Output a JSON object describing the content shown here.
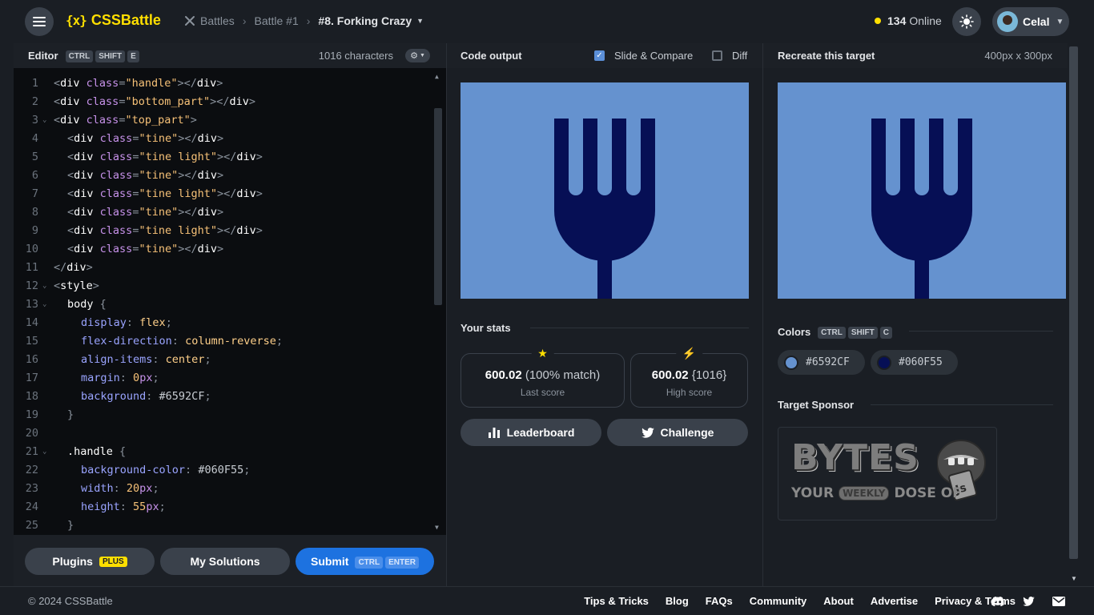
{
  "header": {
    "logo_mark": "{x}",
    "logo_text": "CSSBattle",
    "crumb_battles": "Battles",
    "crumb_battle": "Battle #1",
    "crumb_current": "#8. Forking Crazy",
    "online_count": "134",
    "online_label": "Online",
    "user_name": "Celal",
    "accent_color": "#ffdf00"
  },
  "editor": {
    "title": "Editor",
    "shortcut_keys": [
      "CTRL",
      "SHIFT",
      "E"
    ],
    "char_count": "1016 characters",
    "line_numbers": [
      "1",
      "2",
      "3",
      "4",
      "5",
      "6",
      "7",
      "8",
      "9",
      "10",
      "11",
      "12",
      "13",
      "14",
      "15",
      "16",
      "17",
      "18",
      "19",
      "20",
      "21",
      "22",
      "23",
      "24",
      "25"
    ],
    "lines": {
      "l1": [
        "<",
        "div",
        " class",
        "=",
        "\"handle\"",
        "></",
        "div",
        ">"
      ],
      "l2": [
        "<",
        "div",
        " class",
        "=",
        "\"bottom_part\"",
        "></",
        "div",
        ">"
      ],
      "l3": [
        "<",
        "div",
        " class",
        "=",
        "\"top_part\"",
        ">"
      ],
      "l4": [
        "<",
        "div",
        " class",
        "=",
        "\"tine\"",
        "></",
        "div",
        ">"
      ],
      "l5": [
        "<",
        "div",
        " class",
        "=",
        "\"tine light\"",
        "></",
        "div",
        ">"
      ],
      "l6": [
        "<",
        "div",
        " class",
        "=",
        "\"tine\"",
        "></",
        "div",
        ">"
      ],
      "l7": [
        "<",
        "div",
        " class",
        "=",
        "\"tine light\"",
        "></",
        "div",
        ">"
      ],
      "l8": [
        "<",
        "div",
        " class",
        "=",
        "\"tine\"",
        "></",
        "div",
        ">"
      ],
      "l9": [
        "<",
        "div",
        " class",
        "=",
        "\"tine light\"",
        "></",
        "div",
        ">"
      ],
      "l10": [
        "<",
        "div",
        " class",
        "=",
        "\"tine\"",
        "></",
        "div",
        ">"
      ],
      "l11": [
        "</",
        "div",
        ">"
      ],
      "l12": [
        "<",
        "style",
        ">"
      ],
      "l13": [
        "body",
        " {"
      ],
      "l14": [
        "display",
        ": ",
        "flex",
        ";"
      ],
      "l15": [
        "flex-direction",
        ": ",
        "column-reverse",
        ";"
      ],
      "l16": [
        "align-items",
        ": ",
        "center",
        ";"
      ],
      "l17": [
        "margin",
        ": ",
        "0",
        "px",
        ";"
      ],
      "l18": [
        "background",
        ": ",
        "#6592CF",
        ";"
      ],
      "l19": [
        "}"
      ],
      "l21": [
        ".handle",
        " {"
      ],
      "l22": [
        "background-color",
        ": ",
        "#060F55",
        ";"
      ],
      "l23": [
        "width",
        ": ",
        "20",
        "px",
        ";"
      ],
      "l24": [
        "height",
        ": ",
        "55",
        "px",
        ";"
      ],
      "l25": [
        "}"
      ]
    },
    "plugins_label": "Plugins",
    "plugins_badge": "PLUS",
    "solutions_label": "My Solutions",
    "submit_label": "Submit",
    "submit_keys": [
      "CTRL",
      "ENTER"
    ]
  },
  "output": {
    "title": "Code output",
    "slide_compare_label": "Slide & Compare",
    "slide_compare_checked": true,
    "diff_label": "Diff",
    "diff_checked": false,
    "stats_title": "Your stats",
    "last_score": "600.02",
    "last_match": "(100% match)",
    "last_label": "Last score",
    "high_score": "600.02",
    "high_chars": "{1016}",
    "high_label": "High score",
    "leaderboard_label": "Leaderboard",
    "challenge_label": "Challenge"
  },
  "target": {
    "title": "Recreate this target",
    "dimensions": "400px x 300px",
    "colors_title": "Colors",
    "colors_keys": [
      "CTRL",
      "SHIFT",
      "C"
    ],
    "colors": [
      "#6592CF",
      "#060F55"
    ],
    "sponsor_title": "Target Sponsor",
    "sponsor_brand": "BYTES",
    "sponsor_tagline_1": "YOUR",
    "sponsor_tagline_2": "WEEKLY",
    "sponsor_tagline_3": "DOSE OF"
  },
  "footer": {
    "copyright": "© 2024 CSSBattle",
    "links": [
      "Tips & Tricks",
      "Blog",
      "FAQs",
      "Community",
      "About",
      "Advertise",
      "Privacy & Terms"
    ],
    "icons": [
      "discord-icon",
      "twitter-icon",
      "mail-icon"
    ]
  }
}
